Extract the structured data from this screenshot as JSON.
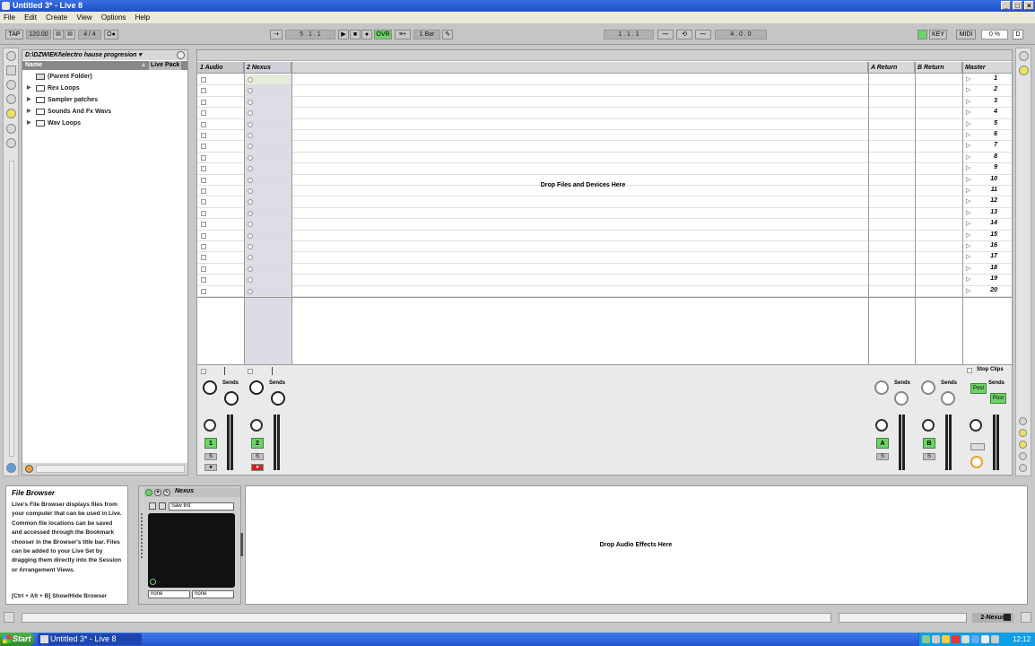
{
  "window": {
    "title": "Untitled 3* - Live 8",
    "controls": [
      "_",
      "□",
      "×"
    ]
  },
  "menu": [
    "File",
    "Edit",
    "Create",
    "View",
    "Options",
    "Help"
  ],
  "transport": {
    "tap": "TAP",
    "tempo": "120.00",
    "nudge_left": "III",
    "nudge_right": "III",
    "signature": "4 / 4",
    "metronome": "O●",
    "follow": "⇢",
    "position": [
      "5 .",
      "1 .",
      "1"
    ],
    "play": "▶",
    "stop": "■",
    "record": "●",
    "overdub": "OVR",
    "quantize": "1 Bar",
    "loop_start": [
      "1 .",
      "1 .",
      "1"
    ],
    "punch_in": "⁓",
    "loop": "⟲",
    "punch_out": "⁓",
    "loop_length": [
      "4 .",
      "0 .",
      "0"
    ],
    "key": "KEY",
    "midi": "MIDI",
    "cpu": "0 %",
    "disk": "D"
  },
  "browser": {
    "path": "D:\\DZWIEKI\\electro hause progresion ▾",
    "columns": {
      "name": "Name",
      "live_pack": "Live Pack"
    },
    "items": [
      {
        "label": "(Parent Folder)",
        "expandable": false
      },
      {
        "label": "Rex Loops",
        "expandable": true
      },
      {
        "label": "Sampler patches",
        "expandable": true
      },
      {
        "label": "Sounds And Fx Wavs",
        "expandable": true
      },
      {
        "label": "Wav Loops",
        "expandable": true
      }
    ]
  },
  "session": {
    "tracks": [
      {
        "name": "1 Audio",
        "num": "1",
        "type": "audio"
      },
      {
        "name": "2 Nexus",
        "num": "2",
        "type": "midi"
      }
    ],
    "returns": [
      {
        "name": "A Return",
        "num": "A"
      },
      {
        "name": "B Return",
        "num": "B"
      }
    ],
    "master": {
      "name": "Master",
      "stop_clips": "Stop Clips",
      "post": "Post"
    },
    "scenes": [
      "1",
      "2",
      "3",
      "4",
      "5",
      "6",
      "7",
      "8",
      "9",
      "10",
      "11",
      "12",
      "13",
      "14",
      "15",
      "16",
      "17",
      "18",
      "19",
      "20"
    ],
    "drop_text": "Drop Files and Devices Here",
    "sends_label": "Sends",
    "send_a": "A",
    "send_b": "B",
    "solo": "S"
  },
  "info": {
    "title": "File Browser",
    "body": "Live's File Browser displays files from your computer that can be used in Live. Common file locations can be saved and accessed through the Bookmark chooser in the Browser's title bar. Files can be added to your Live Set by dragging them directly into the Session or Arrangement Views.",
    "shortcut": "[Ctrl + Alt + B] Show/Hide Browser"
  },
  "device": {
    "name": "Nexus",
    "preset": "Saw Init",
    "param1": "none",
    "param2": "none"
  },
  "device_drop": "Drop Audio Effects Here",
  "status": {
    "track": "2-Nexus"
  },
  "taskbar": {
    "start": "Start",
    "task": "Untitled 3* - Live 8",
    "time": "12:12"
  },
  "colors": {
    "green": "#6fd16a",
    "orange": "#f0a030",
    "record_red": "#d02020"
  }
}
